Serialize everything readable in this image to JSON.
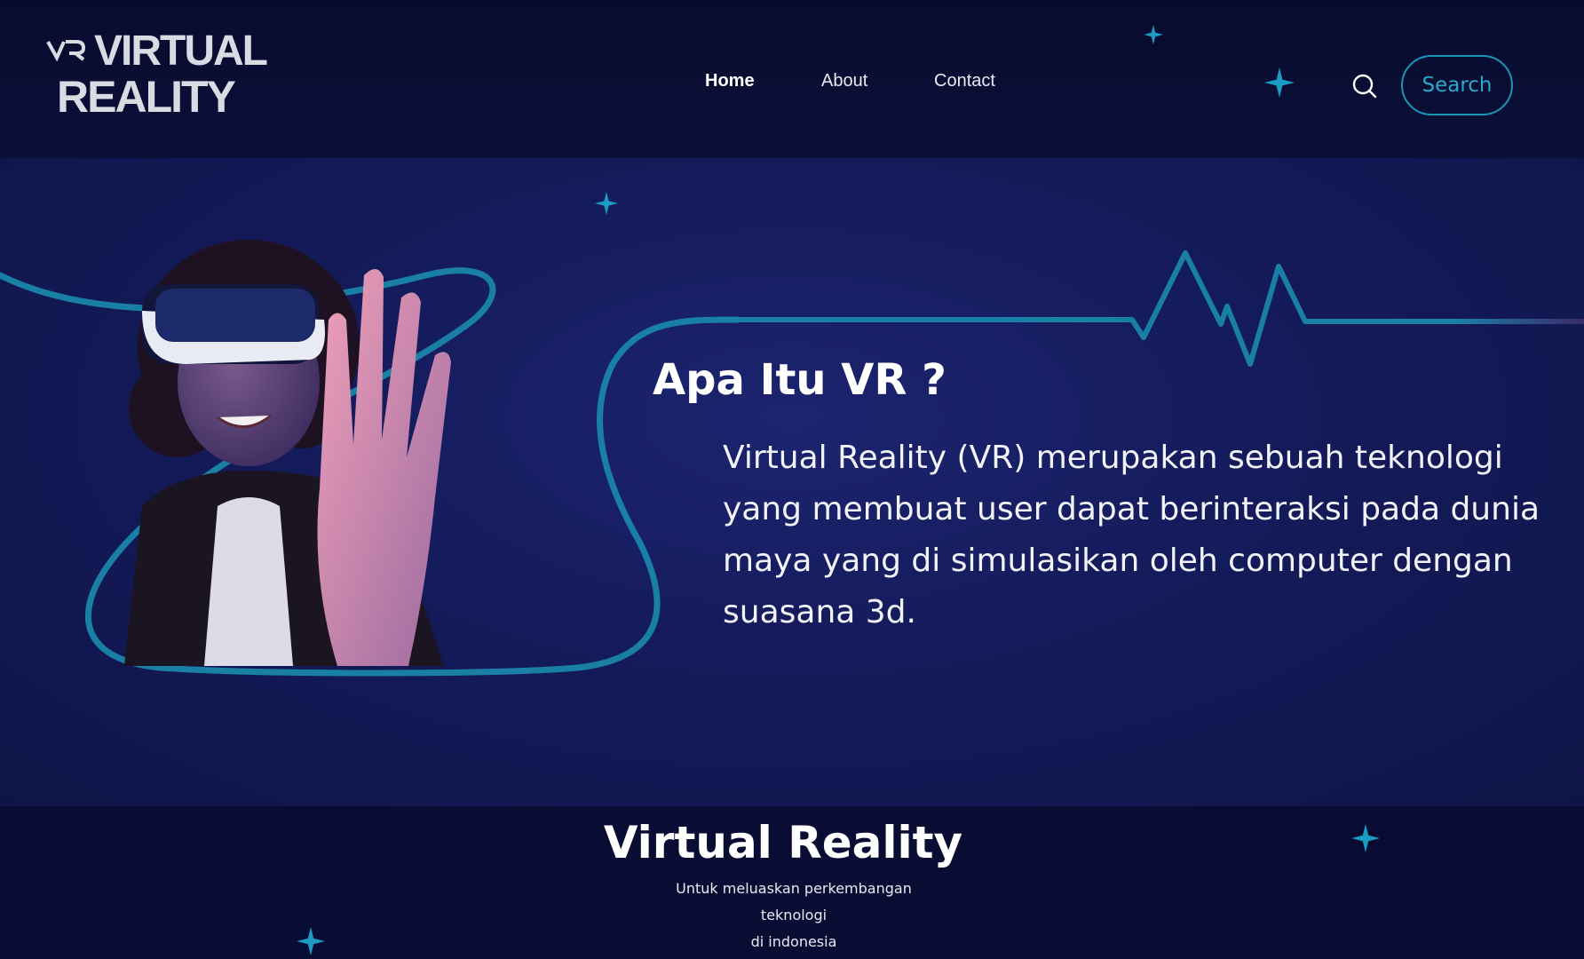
{
  "header": {
    "logo": {
      "line1": "VIRTUAL",
      "line2": "REALITY",
      "mark": "VR"
    },
    "nav": [
      {
        "label": "Home",
        "active": true
      },
      {
        "label": "About",
        "active": false
      },
      {
        "label": "Contact",
        "active": false
      }
    ],
    "search": {
      "icon": "search-icon",
      "button_label": "Search"
    }
  },
  "hero": {
    "image": "person-wearing-vr-headset",
    "title": "Apa Itu VR ?",
    "body": "Virtual Reality (VR) merupakan sebuah teknologi yang membuat user dapat berinteraksi pada dunia maya yang di simulasikan oleh computer dengan suasana 3d."
  },
  "intro": {
    "title": "Virtual Reality",
    "subtitle_line1": "Untuk meluaskan perkembangan teknologi",
    "subtitle_line2": "di indonesia"
  },
  "colors": {
    "background": "#0a0d33",
    "hero": "#141b5a",
    "accent": "#1896b5",
    "text": "#ffffff"
  }
}
